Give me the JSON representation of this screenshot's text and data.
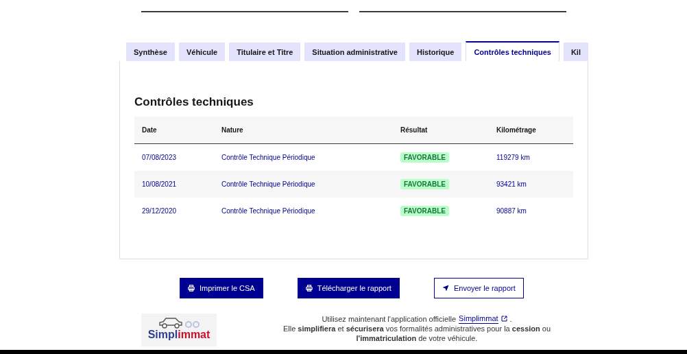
{
  "top_fields": [
    {
      "kind": "field"
    },
    {
      "kind": "field"
    }
  ],
  "tabs": [
    {
      "label": "Synthèse",
      "selected": false
    },
    {
      "label": "Véhicule",
      "selected": false
    },
    {
      "label": "Titulaire et Titre",
      "selected": false
    },
    {
      "label": "Situation administrative",
      "selected": false
    },
    {
      "label": "Historique",
      "selected": false
    },
    {
      "label": "Contrôles techniques",
      "selected": true
    },
    {
      "label": "Kil",
      "selected": false
    }
  ],
  "section": {
    "title": "Contrôles techniques",
    "table": {
      "columns": [
        "Date",
        "Nature",
        "Résultat",
        "Kilométrage"
      ],
      "rows": [
        {
          "date": "07/08/2023",
          "nature": "Contrôle Technique Périodique",
          "result": "FAVORABLE",
          "km": "119279 km"
        },
        {
          "date": "10/08/2021",
          "nature": "Contrôle Technique Périodique",
          "result": "FAVORABLE",
          "km": "93421 km"
        },
        {
          "date": "29/12/2020",
          "nature": "Contrôle Technique Périodique",
          "result": "FAVORABLE",
          "km": "90887 km"
        }
      ]
    }
  },
  "actions": [
    {
      "label": "Imprimer le CSA",
      "kind": "primary"
    },
    {
      "label": "Télécharger le rapport",
      "kind": "primary"
    },
    {
      "label": "Envoyer le rapport",
      "kind": "secondary"
    }
  ],
  "footer": {
    "logo": {
      "first": "Simpl",
      "second": "immat"
    },
    "line1": "Utilisez maintenant l'application officielle",
    "link": "Simplimmat",
    "line1_end": ".",
    "line2": "Elle **simplifiera** et **sécurisera** vos formalités administratives pour la **cession** ou **l'immatriculation** de votre véhicule."
  }
}
